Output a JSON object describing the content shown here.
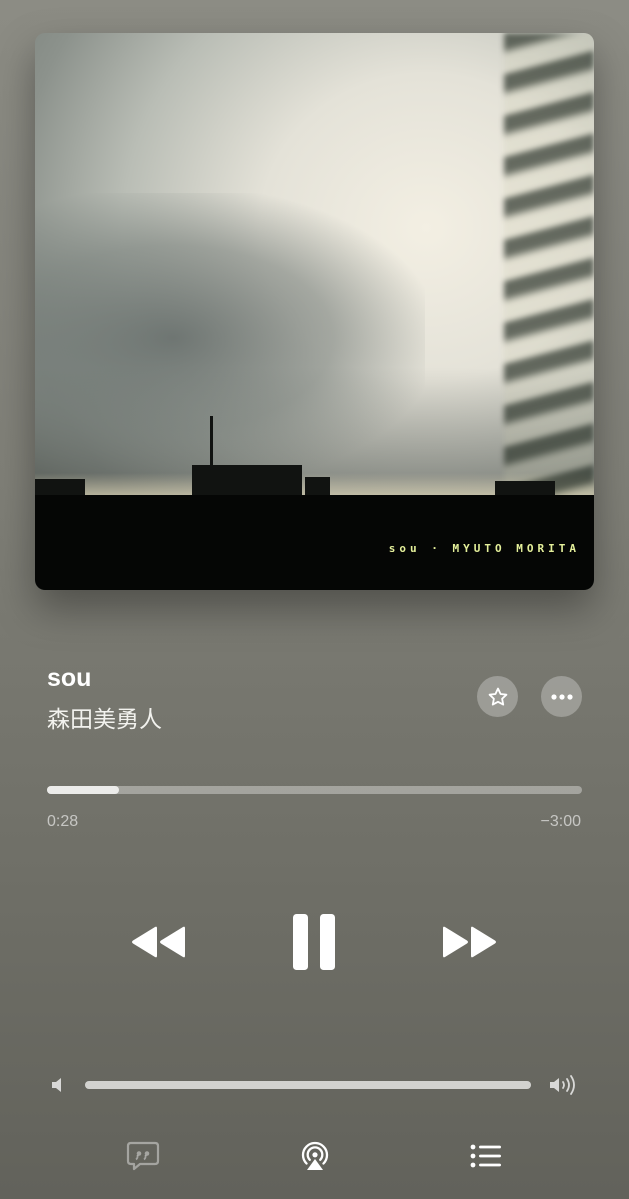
{
  "artwork": {
    "album_text": "sou · MYUTO MORITA"
  },
  "track": {
    "title": "sou",
    "artist": "森田美勇人"
  },
  "progress": {
    "elapsed": "0:28",
    "remaining": "−3:00",
    "fraction": 0.134
  },
  "volume": {
    "level": 1.0
  },
  "icons": {
    "favorite": "star-icon",
    "more": "ellipsis-icon",
    "rewind": "rewind-icon",
    "pause": "pause-icon",
    "forward": "fast-forward-icon",
    "volume_low": "speaker-low-icon",
    "volume_high": "speaker-high-icon",
    "lyrics": "lyrics-quote-icon",
    "airplay": "airplay-icon",
    "queue": "queue-list-icon"
  },
  "colors": {
    "album_text": "#e4ef9a",
    "foreground": "#ffffff"
  }
}
